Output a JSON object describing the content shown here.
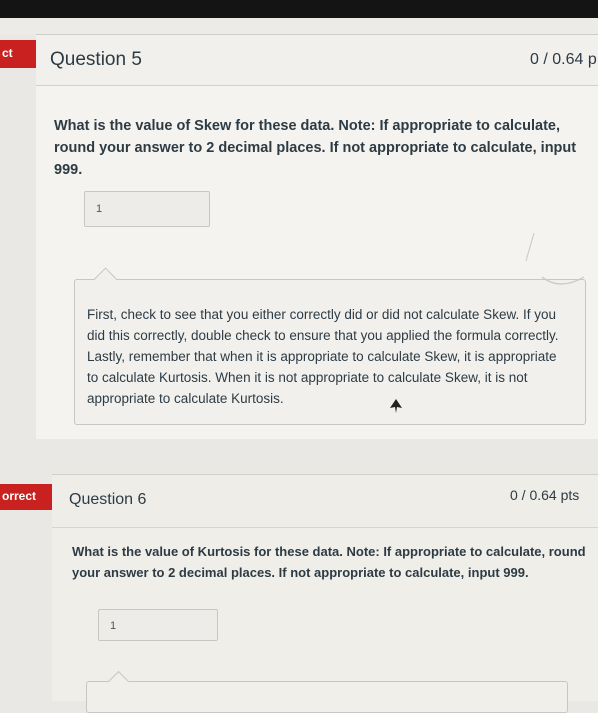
{
  "question5": {
    "tab_label": "ct",
    "title": "Question 5",
    "points": "0 / 0.64 p",
    "text": "What is the value of Skew for these data. Note: If appropriate to calculate, round your answer to 2 decimal places. If not appropriate to calculate, input 999.",
    "answer_value": "1",
    "feedback": "First, check to see that you either correctly did or did not calculate Skew. If you did this correctly, double check to ensure that you applied the formula correctly. Lastly, remember that when it is appropriate to calculate Skew, it is appropriate to calculate Kurtosis. When it is not appropriate to calculate Skew, it is not appropriate to calculate Kurtosis."
  },
  "question6": {
    "tab_label": "orrect",
    "title": "Question 6",
    "points": "0 / 0.64 pts",
    "text": "What is the value of Kurtosis for these data. Note: If appropriate to calculate, round your answer to 2 decimal places. If not appropriate to calculate, input 999.",
    "answer_value": "1"
  },
  "colors": {
    "incorrect_tab": "#c8211f",
    "card_bg": "#f4f3ef",
    "text": "#2d3b45"
  },
  "icons": [
    "mouse-pointer-icon",
    "pen-scribble"
  ]
}
